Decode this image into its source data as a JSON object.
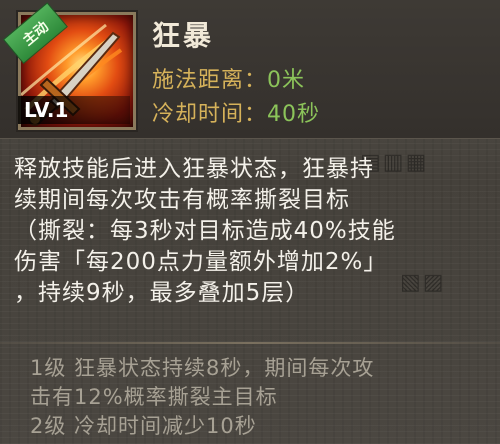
{
  "skill": {
    "tag": "主动",
    "level": "LV.1",
    "name": "狂暴",
    "cast_range_label": "施法距离：",
    "cast_range_value": "0米",
    "cooldown_label": "冷却时间：",
    "cooldown_value": "40秒"
  },
  "description": [
    "释放技能后进入狂暴状态，狂暴持",
    "续期间每次攻击有概率撕裂目标",
    "（撕裂：每3秒对目标造成40%技能",
    "伤害「每200点力量额外增加2%」",
    "，持续9秒，最多叠加5层）"
  ],
  "upgrades": [
    "1级 狂暴状态持续8秒，期间每次攻",
    "击有12%概率撕裂主目标",
    "2级 冷却时间减少10秒"
  ],
  "colors": {
    "label_gold": "#d6b25a",
    "value_green": "#8cc45a",
    "tag_green": "#3f9e4a"
  }
}
